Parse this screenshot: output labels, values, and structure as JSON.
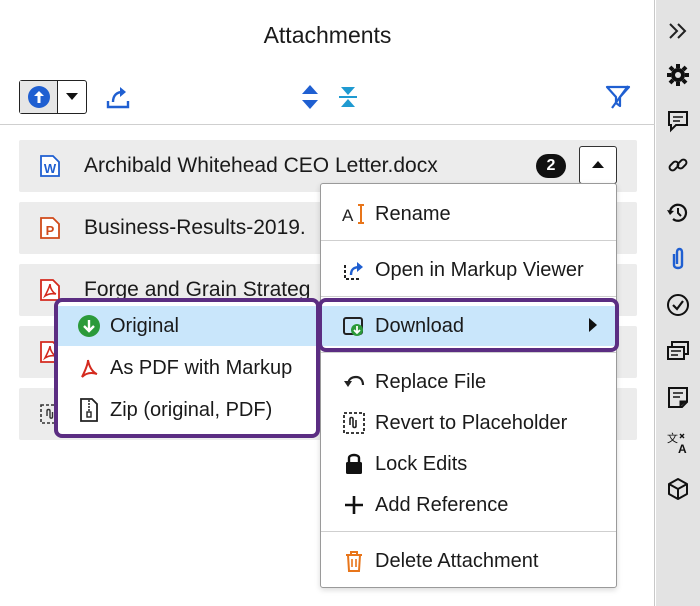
{
  "panel": {
    "title": "Attachments"
  },
  "attachments": [
    {
      "name": "Archibald Whitehead CEO Letter.docx",
      "badge": "2",
      "type": "word"
    },
    {
      "name": "Business-Results-2019.",
      "type": "powerpoint"
    },
    {
      "name": "Forge and Grain Strateg",
      "type": "pdf"
    },
    {
      "name": "",
      "type": "pdf"
    },
    {
      "name": "",
      "type": "placeholder"
    }
  ],
  "context_menu": {
    "items": [
      {
        "label": "Rename",
        "icon": "rename-icon"
      },
      {
        "label": "Open in Markup Viewer",
        "icon": "open-viewer-icon"
      },
      {
        "label": "Download",
        "icon": "download-icon"
      },
      {
        "label": "Replace File",
        "icon": "replace-icon"
      },
      {
        "label": "Revert to Placeholder",
        "icon": "placeholder-icon"
      },
      {
        "label": "Lock Edits",
        "icon": "lock-icon"
      },
      {
        "label": "Add Reference",
        "icon": "plus-icon"
      },
      {
        "label": "Delete Attachment",
        "icon": "trash-icon"
      }
    ]
  },
  "download_submenu": {
    "items": [
      {
        "label": "Original",
        "icon": "download-circle-icon"
      },
      {
        "label": "As PDF with Markup",
        "icon": "pdf-icon"
      },
      {
        "label": "Zip (original, PDF)",
        "icon": "zip-icon"
      }
    ]
  },
  "colors": {
    "accent": "#1f5fd1",
    "highlight": "#c9e6fb",
    "callout": "#5b2d82",
    "pdf_red": "#d42a1e",
    "ppt_orange": "#d04a1a",
    "download_green": "#2b9a3a",
    "trash_orange": "#e8751a"
  }
}
